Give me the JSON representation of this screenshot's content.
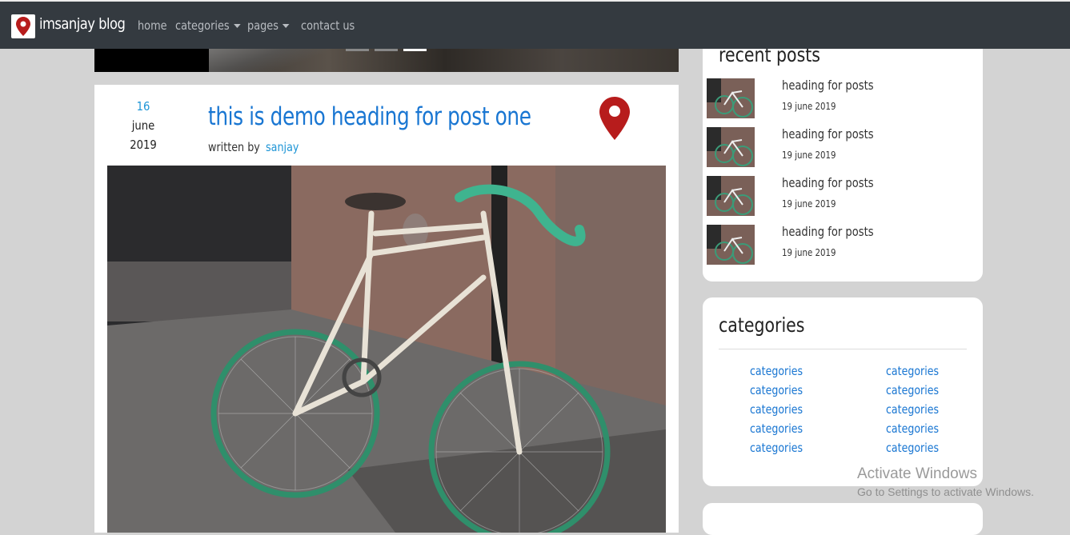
{
  "navbar": {
    "brand": "imsanjay blog",
    "items": [
      {
        "label": "home",
        "has_dropdown": false
      },
      {
        "label": "categories",
        "has_dropdown": true
      },
      {
        "label": "pages",
        "has_dropdown": true
      },
      {
        "label": "contact us",
        "has_dropdown": false
      }
    ],
    "background": "#343a40",
    "icon": "map-pin-icon"
  },
  "slider": {
    "indicator_count": 3,
    "active_index": 2
  },
  "post": {
    "date_day": "16",
    "date_month": "june",
    "date_year": "2019",
    "title": "this is demo heading for post one",
    "written_by_label": "written by",
    "author": "sanjay",
    "pin_icon": "map-pin-icon",
    "image": "bicycle-photo"
  },
  "sidebar": {
    "recent_posts": {
      "heading": "recent posts",
      "items": [
        {
          "title": "heading for posts",
          "date": "19 june 2019"
        },
        {
          "title": "heading for posts",
          "date": "19 june 2019"
        },
        {
          "title": "heading for posts",
          "date": "19 june 2019"
        },
        {
          "title": "heading for posts",
          "date": "19 june 2019"
        }
      ]
    },
    "categories": {
      "heading": "categories",
      "links": [
        "categories",
        "categories",
        "categories",
        "categories",
        "categories",
        "categories",
        "categories",
        "categories",
        "categories",
        "categories"
      ]
    }
  },
  "watermark": {
    "title": "Activate Windows",
    "subtitle": "Go to Settings to activate Windows."
  },
  "colors": {
    "accent_link": "#1976d2",
    "date_accent": "#1e95d6",
    "pin_red": "#b71c1c",
    "page_background": "#d3d3d3"
  }
}
